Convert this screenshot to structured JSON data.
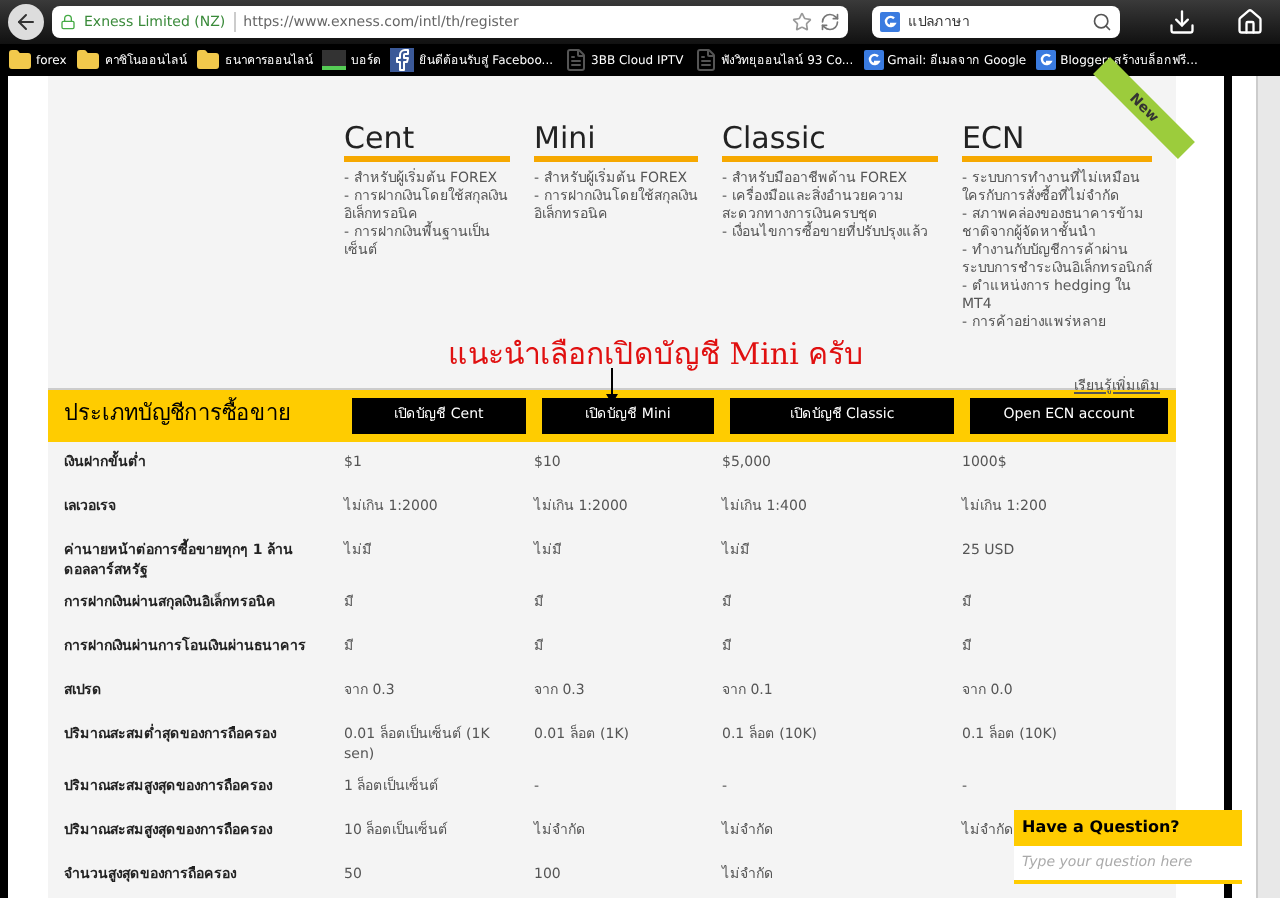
{
  "browser": {
    "site_identity": "Exness Limited (NZ)",
    "url": "https://www.exness.com/intl/th/register",
    "search_text": "แปลภาษา",
    "bookmarks": [
      {
        "label": "forex",
        "kind": "folder"
      },
      {
        "label": "คาซิโนออนไลน์",
        "kind": "folder"
      },
      {
        "label": "ธนาคารออนไลน์",
        "kind": "folder"
      },
      {
        "label": "บอร์ด",
        "kind": "board"
      },
      {
        "label": "ยินดีต้อนรับสู่ Faceboo...",
        "kind": "facebook"
      },
      {
        "label": "3BB Cloud IPTV",
        "kind": "page"
      },
      {
        "label": "ฟังวิทยุออนไลน์ 93 Co...",
        "kind": "page"
      },
      {
        "label": "Gmail: อีเมลจาก Google",
        "kind": "google"
      },
      {
        "label": "Blogger: สร้างบล็อกฟรี...",
        "kind": "google"
      }
    ]
  },
  "ribbon": "New",
  "plans": [
    {
      "name": "Cent",
      "features": [
        "- สำหรับผู้เริ่มต้น FOREX",
        "- การฝากเงินโดยใช้สกุลเงินอิเล็กทรอนิค",
        "- การฝากเงินพื้นฐานเป็นเซ็นต์"
      ],
      "button": "เปิดบัญชี Cent"
    },
    {
      "name": "Mini",
      "features": [
        "- สำหรับผู้เริ่มต้น FOREX",
        "- การฝากเงินโดยใช้สกุลเงินอิเล็กทรอนิค"
      ],
      "button": "เปิดบัญชี Mini"
    },
    {
      "name": "Classic",
      "features": [
        "- สำหรับมืออาชีพด้าน FOREX",
        "- เครื่องมือและสิ่งอำนวยความสะดวกทางการเงินครบชุด",
        "- เงื่อนไขการซื้อขายที่ปรับปรุงแล้ว"
      ],
      "button": "เปิดบัญชี Classic"
    },
    {
      "name": "ECN",
      "features": [
        "- ระบบการทำงานที่ไม่เหมือนใครกับการสั่งซื้อที่ไม่จำกัด",
        "- สภาพคล่องของธนาคารข้ามชาติจากผู้จัดหาชั้นนำ",
        "- ทำงานกับบัญชีการค้าผ่านระบบการชำระเงินอิเล็กทรอนิกส์",
        "- ตำแหน่งการ hedging ใน MT4",
        "- การค้าอย่างแพร่หลาย"
      ],
      "button": "Open ECN account"
    }
  ],
  "learn_more": "เรียนรู้เพิ่มเติม",
  "annotation": "แนะนำเลือกเปิดบัญชี Mini ครับ",
  "table": {
    "title": "ประเภทบัญชีการซื้อขาย",
    "rows": [
      {
        "label": "เงินฝากขั้นต่ำ",
        "values": [
          "$1",
          "$10",
          "$5,000",
          "1000$"
        ]
      },
      {
        "label": "เลเวอเรจ",
        "values": [
          "ไม่เกิน 1:2000",
          "ไม่เกิน 1:2000",
          "ไม่เกิน 1:400",
          "ไม่เกิน 1:200"
        ]
      },
      {
        "label": "ค่านายหน้าต่อการซื้อขายทุกๆ 1 ล้านดอลลาร์สหรัฐ",
        "values": [
          "ไม่มี",
          "ไม่มี",
          "ไม่มี",
          "25 USD"
        ]
      },
      {
        "label": "การฝากเงินผ่านสกุลเงินอิเล็กทรอนิค",
        "values": [
          "มี",
          "มี",
          "มี",
          "มี"
        ]
      },
      {
        "label": "การฝากเงินผ่านการโอนเงินผ่านธนาคาร",
        "values": [
          "มี",
          "มี",
          "มี",
          "มี"
        ]
      },
      {
        "label": "สเปรด",
        "values": [
          "จาก 0.3",
          "จาก 0.3",
          "จาก 0.1",
          "จาก 0.0"
        ]
      },
      {
        "label": "ปริมาณสะสมต่ำสุดของการถือครอง",
        "values": [
          "0.01 ล็อตเป็นเซ็นต์ (1K sen)",
          "0.01 ล็อต (1K)",
          "0.1 ล็อต (10K)",
          "0.1 ล็อต (10K)"
        ]
      },
      {
        "label": "ปริมาณสะสมสูงสุดของการถือครอง",
        "values": [
          "1 ล็อตเป็นเซ็นต์",
          "-",
          "-",
          "-"
        ]
      },
      {
        "label": "ปริมาณสะสมสูงสุดของการถือครอง",
        "values": [
          "10 ล็อตเป็นเซ็นต์",
          "ไม่จำกัด",
          "ไม่จำกัด",
          "ไม่จำกัด"
        ]
      },
      {
        "label": "จำนวนสูงสุดของการถือครอง",
        "values": [
          "50",
          "100",
          "ไม่จำกัด"
        ]
      }
    ]
  },
  "chat_widget": {
    "title": "Have a Question?",
    "placeholder": "Type your question here"
  }
}
